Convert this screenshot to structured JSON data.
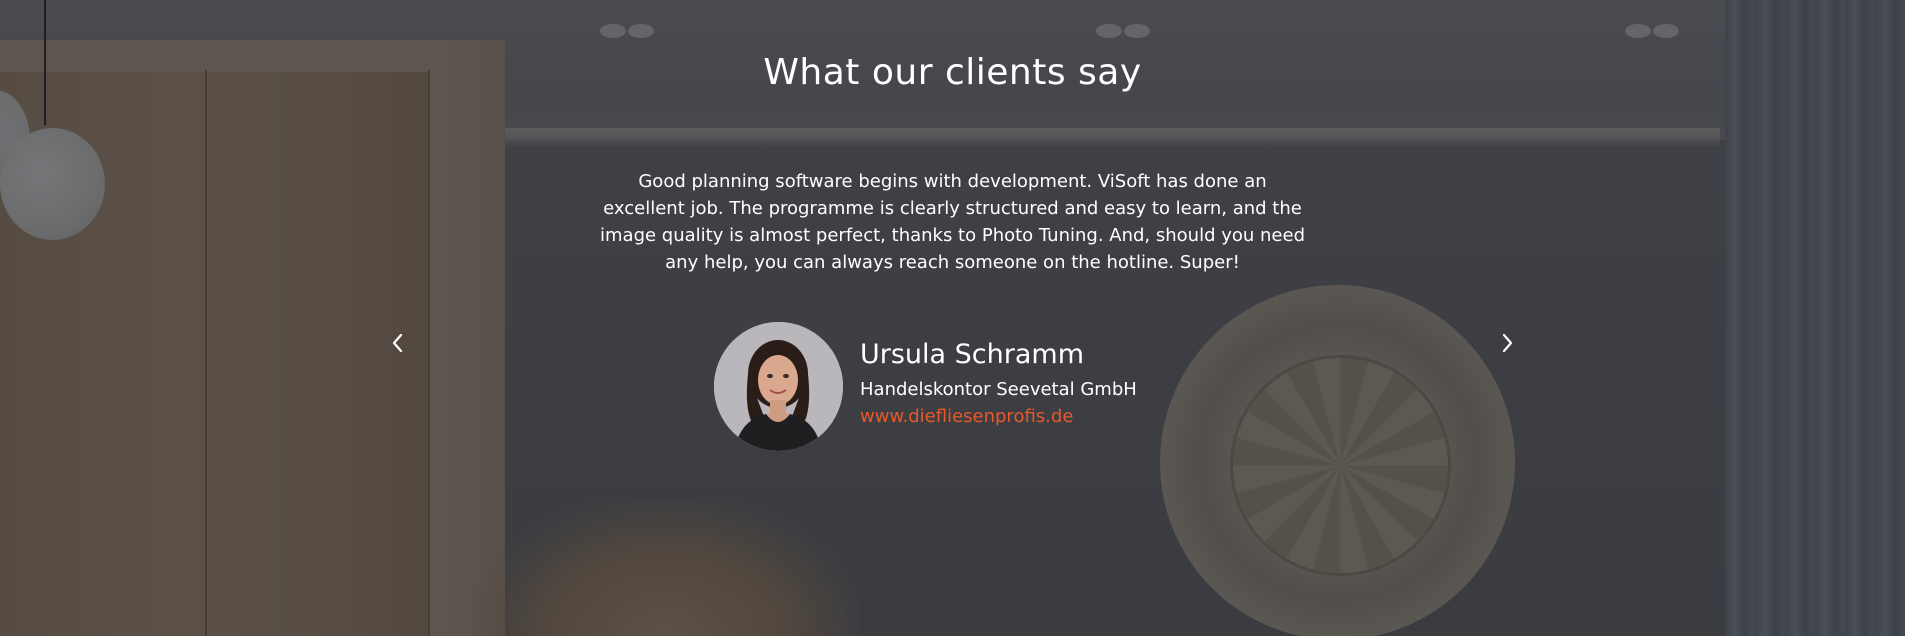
{
  "section": {
    "heading": "What our clients say"
  },
  "testimonial": {
    "quote": "Good planning software begins with development. ViSoft has done an excellent job. The programme is clearly structured and easy to learn, and the image quality is almost perfect, thanks to Photo Tuning. And, should you need any help, you can always reach someone on the hotline. Super!",
    "name": "Ursula Schramm",
    "company": "Handelskontor Seevetal GmbH",
    "website": "www.diefliesenprofis.de"
  },
  "icons": {
    "prev": "chevron-left-icon",
    "next": "chevron-right-icon"
  },
  "colors": {
    "text": "#ffffff",
    "accent": "#e8582a",
    "overlay": "#1c1e22"
  }
}
